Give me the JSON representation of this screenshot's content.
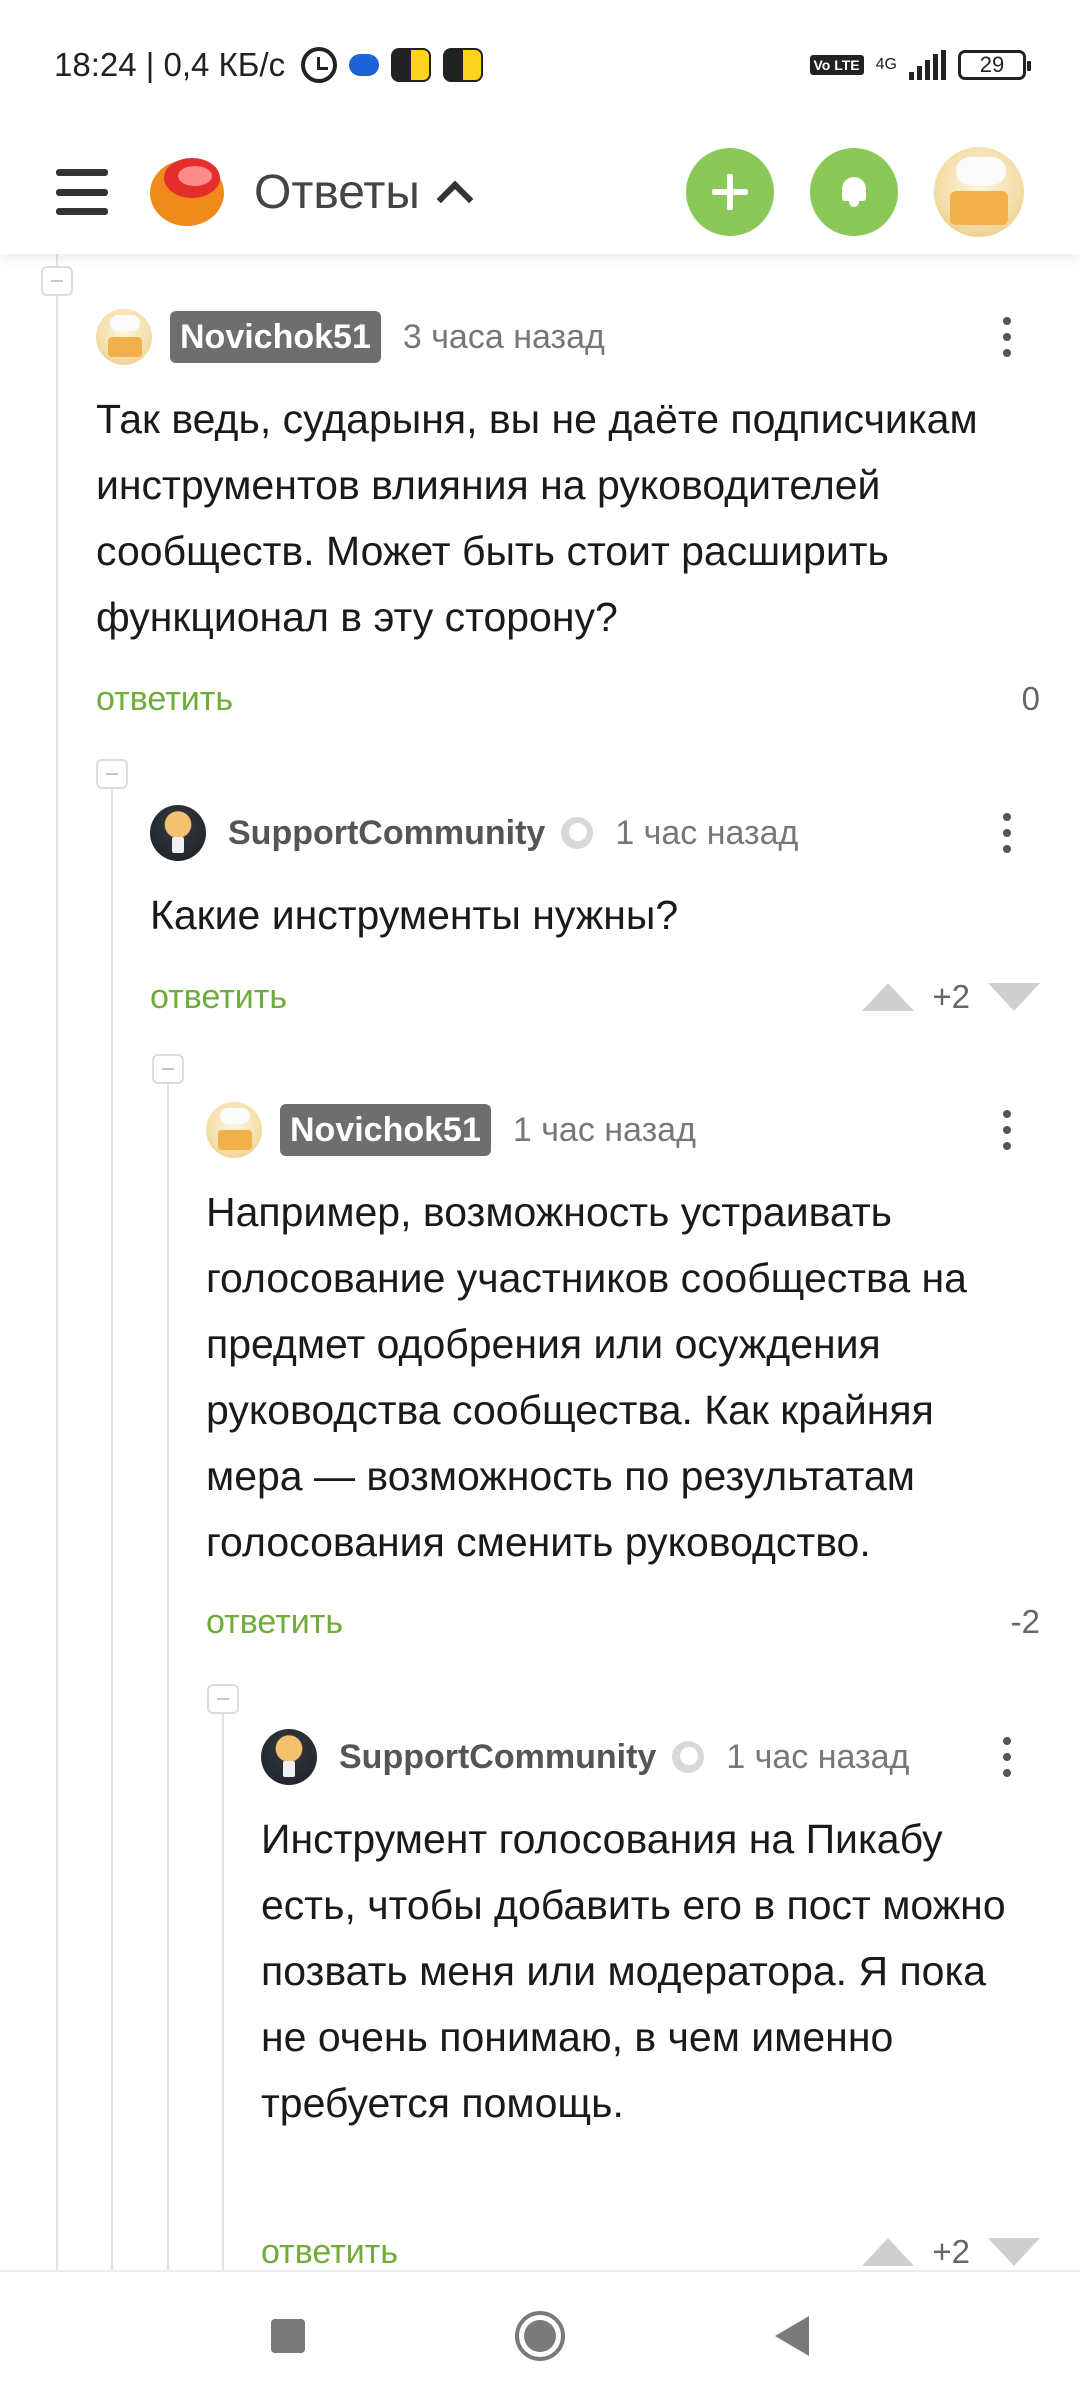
{
  "status_bar": {
    "time_speed": "18:24 | 0,4 КБ/с",
    "volte": "Vo LTE",
    "network": "4G",
    "battery": "29"
  },
  "header": {
    "title": "Ответы",
    "accent_color": "#8ac858"
  },
  "comments": [
    {
      "user": "Novichok51",
      "time": "3 часа назад",
      "text": "Так ведь, сударыня, вы не даёте подписчикам инструментов влияния на руководителей сообществ. Может быть стоит расширить функционал в эту сторону?",
      "reply": "ответить",
      "score": "0"
    },
    {
      "user": "SupportCommunity",
      "time": "1 час назад",
      "text": "Какие инструменты нужны?",
      "reply": "ответить",
      "score": "+2"
    },
    {
      "user": "Novichok51",
      "time": "1 час назад",
      "text": "Например, возможность устраивать голосование участников сообщества на предмет одобрения или осуждения руководства сообщества. Как крайняя мера — возможность по результатам голосования сменить руководство.",
      "reply": "ответить",
      "score": "-2"
    },
    {
      "user": "SupportCommunity",
      "time": "1 час назад",
      "text": "Инструмент голосования на Пикабу есть, чтобы добавить его в пост можно позвать меня или модератора. Я пока не очень понимаю, в чем именно требуется помощь.",
      "reply": "ответить",
      "score": "+2"
    }
  ]
}
